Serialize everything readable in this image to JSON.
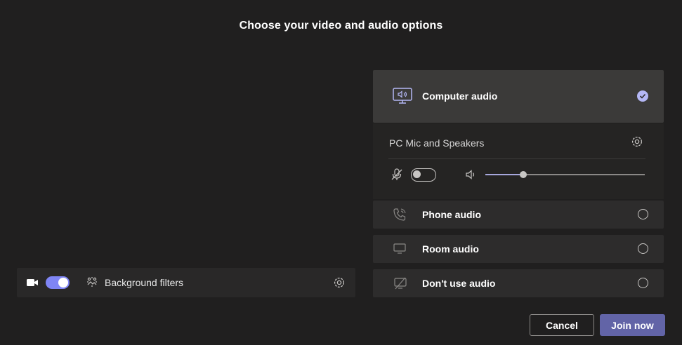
{
  "page": {
    "title": "Choose your video and audio options"
  },
  "preview": {
    "camera_on": true,
    "background_filters_label": "Background filters"
  },
  "audio": {
    "options": [
      {
        "label": "Computer audio",
        "icon": "computer-speaker-icon",
        "selected": true
      },
      {
        "label": "Phone audio",
        "icon": "phone-icon",
        "selected": false
      },
      {
        "label": "Room audio",
        "icon": "room-display-icon",
        "selected": false
      },
      {
        "label": "Don't use audio",
        "icon": "no-audio-icon",
        "selected": false
      }
    ],
    "device_label": "PC Mic and Speakers",
    "mic_on": false,
    "volume_level": 0.24
  },
  "actions": {
    "cancel_label": "Cancel",
    "join_label": "Join now"
  },
  "colors": {
    "accent": "#6264a7",
    "toggle_on": "#7f85f5",
    "check": "#b4b7f5",
    "background": "#201f1f"
  }
}
